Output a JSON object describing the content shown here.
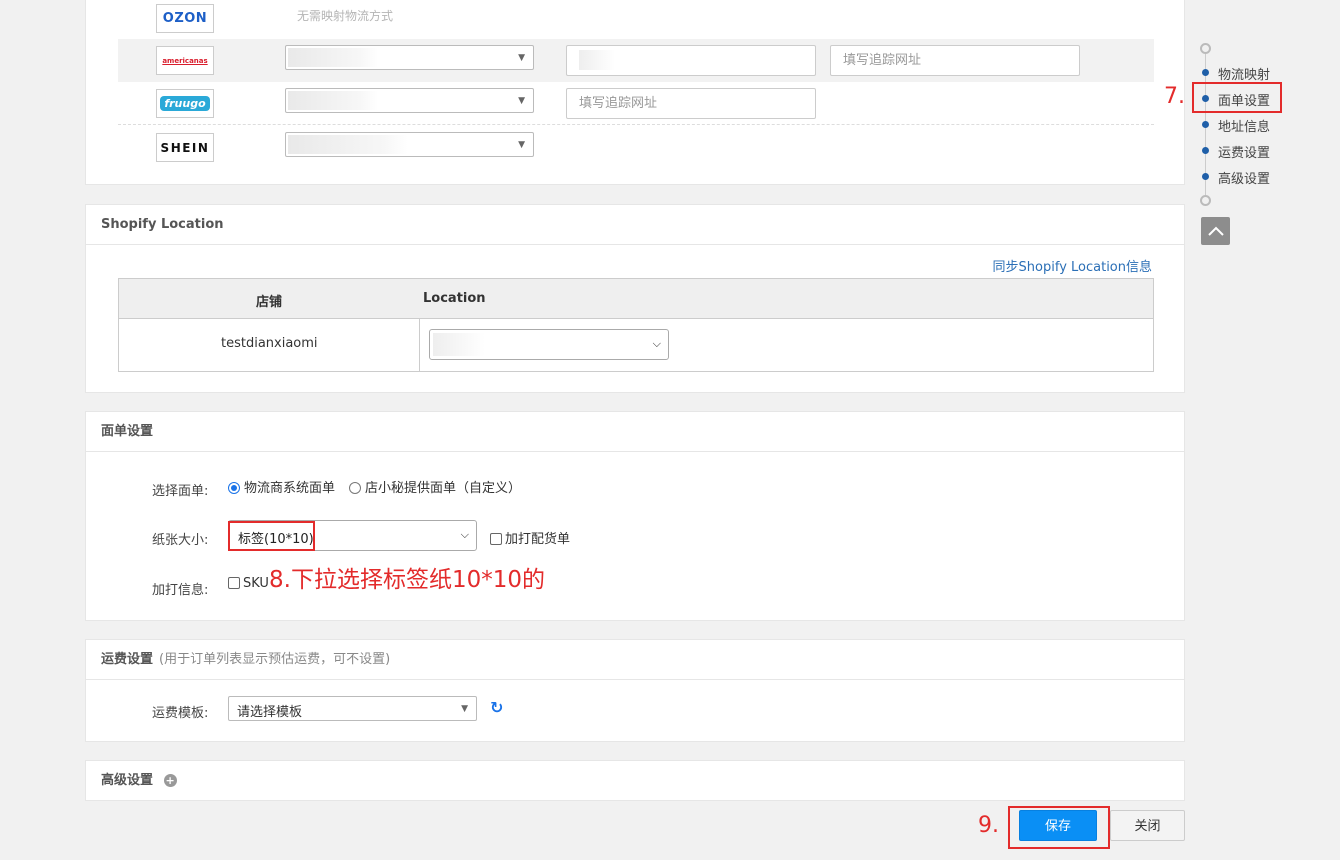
{
  "logistics": {
    "rows": [
      {
        "logo": "OZON",
        "note": "无需映射物流方式"
      },
      {
        "logo": "americanas",
        "tracking_placeholder": "填写追踪网址"
      },
      {
        "logo": "fruugo",
        "tracking_placeholder": "填写追踪网址"
      },
      {
        "logo": "SHEIN"
      }
    ]
  },
  "shopify": {
    "title": "Shopify Location",
    "sync_link": "同步Shopify Location信息",
    "col_store": "店铺",
    "col_location": "Location",
    "store_name": "testdianxiaomi"
  },
  "label_settings": {
    "title": "面单设置",
    "select_label": "选择面单:",
    "option_carrier": "物流商系统面单",
    "option_custom": "店小秘提供面单（自定义）",
    "paper_label": "纸张大小:",
    "paper_value": "标签(10*10)",
    "print_picking": "加打配货单",
    "extra_label": "加打信息:",
    "extra_sku": "SKU"
  },
  "shipping": {
    "title": "运费设置",
    "subtitle": "(用于订单列表显示预估运费，可不设置)",
    "template_label": "运费模板:",
    "template_value": "请选择模板"
  },
  "advanced": {
    "title": "高级设置"
  },
  "nav": {
    "items": [
      "物流映射",
      "面单设置",
      "地址信息",
      "运费设置",
      "高级设置"
    ]
  },
  "buttons": {
    "save": "保存",
    "close": "关闭"
  },
  "annotations": {
    "step7": "7.",
    "step8": "8.下拉选择标签纸10*10的",
    "step9": "9."
  },
  "colors": {
    "accent": "#0a8ff5",
    "annotation": "#e32b2b",
    "nav_dot": "#1f5fa8"
  }
}
